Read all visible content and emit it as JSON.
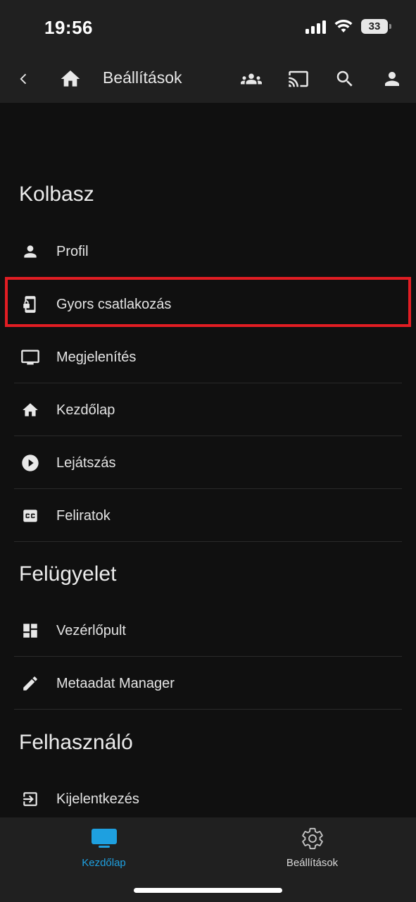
{
  "status_bar": {
    "time": "19:56",
    "battery": "33"
  },
  "app_bar": {
    "title": "Beállítások",
    "icons": [
      "back-icon",
      "home-icon",
      "users-icon",
      "cast-icon",
      "search-icon",
      "account-icon"
    ]
  },
  "sections": [
    {
      "title": "Kolbasz",
      "items": [
        {
          "label": "Profil",
          "icon": "person-icon"
        },
        {
          "label": "Gyors csatlakozás",
          "icon": "quick-connect-icon",
          "highlighted": true
        },
        {
          "label": "Megjelenítés",
          "icon": "monitor-icon"
        },
        {
          "label": "Kezdőlap",
          "icon": "home-icon"
        },
        {
          "label": "Lejátszás",
          "icon": "play-icon"
        },
        {
          "label": "Feliratok",
          "icon": "subtitles-icon"
        }
      ]
    },
    {
      "title": "Felügyelet",
      "items": [
        {
          "label": "Vezérlőpult",
          "icon": "dashboard-icon"
        },
        {
          "label": "Metaadat Manager",
          "icon": "pencil-icon"
        }
      ]
    },
    {
      "title": "Felhasználó",
      "items": [
        {
          "label": "Kijelentkezés",
          "icon": "logout-icon"
        }
      ]
    }
  ],
  "bottom_nav": [
    {
      "label": "Kezdőlap",
      "icon": "tv-icon",
      "active": true
    },
    {
      "label": "Beállítások",
      "icon": "gear-icon",
      "active": false
    }
  ],
  "colors": {
    "accent": "#1ea0e0",
    "highlight_border": "#e21d23",
    "background": "#101010",
    "bar": "#202020"
  }
}
